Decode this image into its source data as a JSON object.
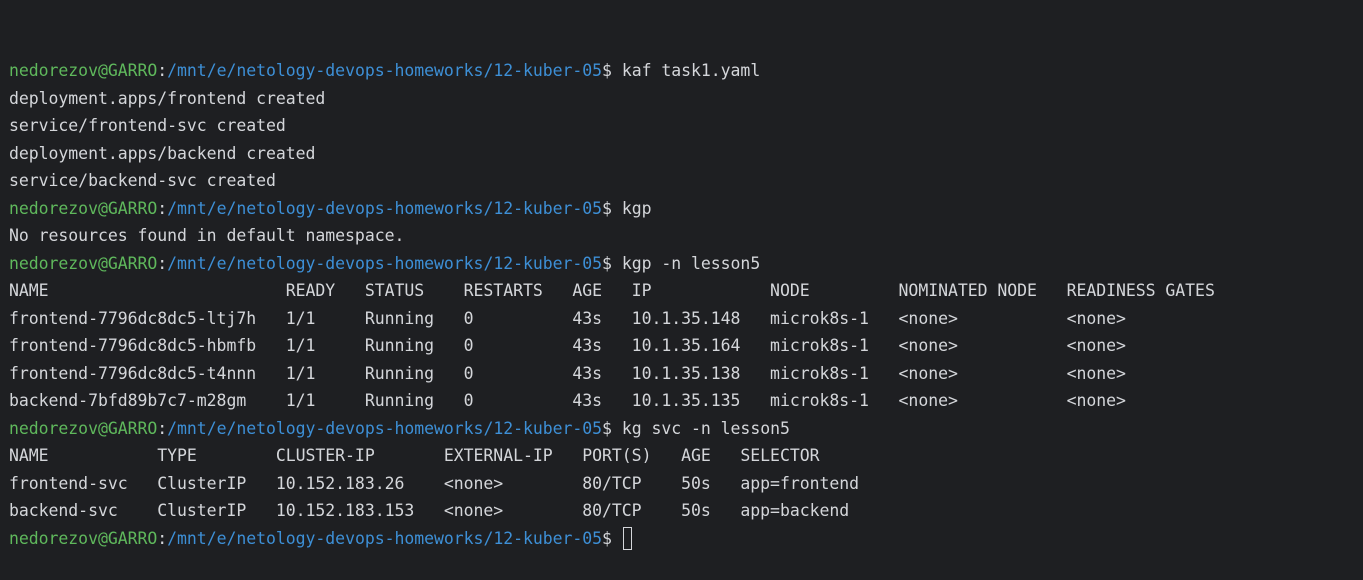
{
  "prompt": {
    "user": "nedorezov@GARRO",
    "separator": ":",
    "path": "/mnt/e/netology-devops-homeworks/12-kuber-05",
    "symbol": "$"
  },
  "lines": [
    {
      "kind": "prompt",
      "command": "kaf task1.yaml"
    },
    {
      "kind": "output",
      "text": "deployment.apps/frontend created"
    },
    {
      "kind": "output",
      "text": "service/frontend-svc created"
    },
    {
      "kind": "output",
      "text": "deployment.apps/backend created"
    },
    {
      "kind": "output",
      "text": "service/backend-svc created"
    },
    {
      "kind": "prompt",
      "command": "kgp"
    },
    {
      "kind": "output",
      "text": "No resources found in default namespace."
    },
    {
      "kind": "prompt",
      "command": "kgp -n lesson5"
    },
    {
      "kind": "output",
      "text": "NAME                        READY   STATUS    RESTARTS   AGE   IP            NODE         NOMINATED NODE   READINESS GATES"
    },
    {
      "kind": "output",
      "text": "frontend-7796dc8dc5-ltj7h   1/1     Running   0          43s   10.1.35.148   microk8s-1   <none>           <none>"
    },
    {
      "kind": "output",
      "text": "frontend-7796dc8dc5-hbmfb   1/1     Running   0          43s   10.1.35.164   microk8s-1   <none>           <none>"
    },
    {
      "kind": "output",
      "text": "frontend-7796dc8dc5-t4nnn   1/1     Running   0          43s   10.1.35.138   microk8s-1   <none>           <none>"
    },
    {
      "kind": "output",
      "text": "backend-7bfd89b7c7-m28gm    1/1     Running   0          43s   10.1.35.135   microk8s-1   <none>           <none>"
    },
    {
      "kind": "prompt",
      "command": "kg svc -n lesson5"
    },
    {
      "kind": "output",
      "text": "NAME           TYPE        CLUSTER-IP       EXTERNAL-IP   PORT(S)   AGE   SELECTOR"
    },
    {
      "kind": "output",
      "text": "frontend-svc   ClusterIP   10.152.183.26    <none>        80/TCP    50s   app=frontend"
    },
    {
      "kind": "output",
      "text": "backend-svc    ClusterIP   10.152.183.153   <none>        80/TCP    50s   app=backend"
    },
    {
      "kind": "prompt",
      "command": "",
      "cursor": true
    }
  ]
}
